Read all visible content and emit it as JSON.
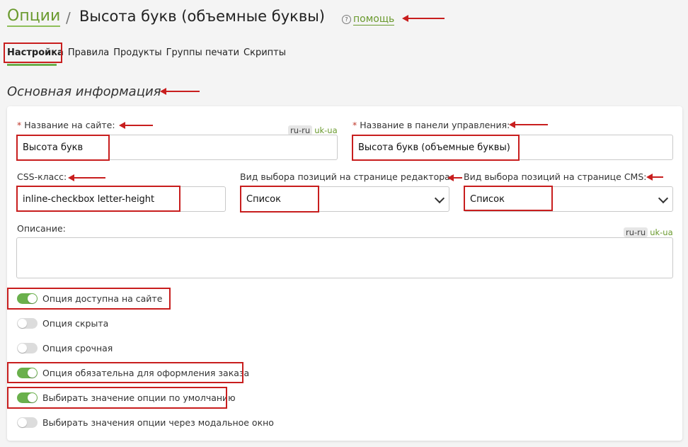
{
  "header": {
    "breadcrumb_root": "Опции",
    "separator": "/",
    "title": "Высота букв (объемные буквы)",
    "help_icon": "?",
    "help_label": "помощь"
  },
  "tabs": [
    {
      "label": "Настройка",
      "active": true
    },
    {
      "label": "Правила",
      "active": false
    },
    {
      "label": "Продукты",
      "active": false
    },
    {
      "label": "Группы печати",
      "active": false
    },
    {
      "label": "Скрипты",
      "active": false
    }
  ],
  "section_title": "Основная информация",
  "form": {
    "required_mark": "*",
    "site_name_label": "Название на сайте:",
    "site_name_value": "Высота букв",
    "admin_name_label": "Название в панели управления:",
    "admin_name_value": "Высота букв (объемные буквы)",
    "lang_ru": "ru-ru",
    "lang_uk": "uk-ua",
    "css_label": "CSS-класс:",
    "css_value": "inline-checkbox letter-height",
    "editor_view_label": "Вид выбора позиций на странице редактора:",
    "editor_view_value": "Список",
    "cms_view_label": "Вид выбора позиций на странице CMS:",
    "cms_view_value": "Список",
    "description_label": "Описание:",
    "description_value": ""
  },
  "toggles": [
    {
      "label": "Опция доступна на сайте",
      "on": true
    },
    {
      "label": "Опция скрыта",
      "on": false
    },
    {
      "label": "Опция срочная",
      "on": false
    },
    {
      "label": "Опция обязательна для оформления заказа",
      "on": true
    },
    {
      "label": "Выбирать значение опции по умолчанию",
      "on": true
    },
    {
      "label": "Выбирать значения опции через модальное окно",
      "on": false
    }
  ],
  "colors": {
    "accent": "#6ab04c",
    "link": "#6a9a2e",
    "annotation": "#c81e1e"
  }
}
